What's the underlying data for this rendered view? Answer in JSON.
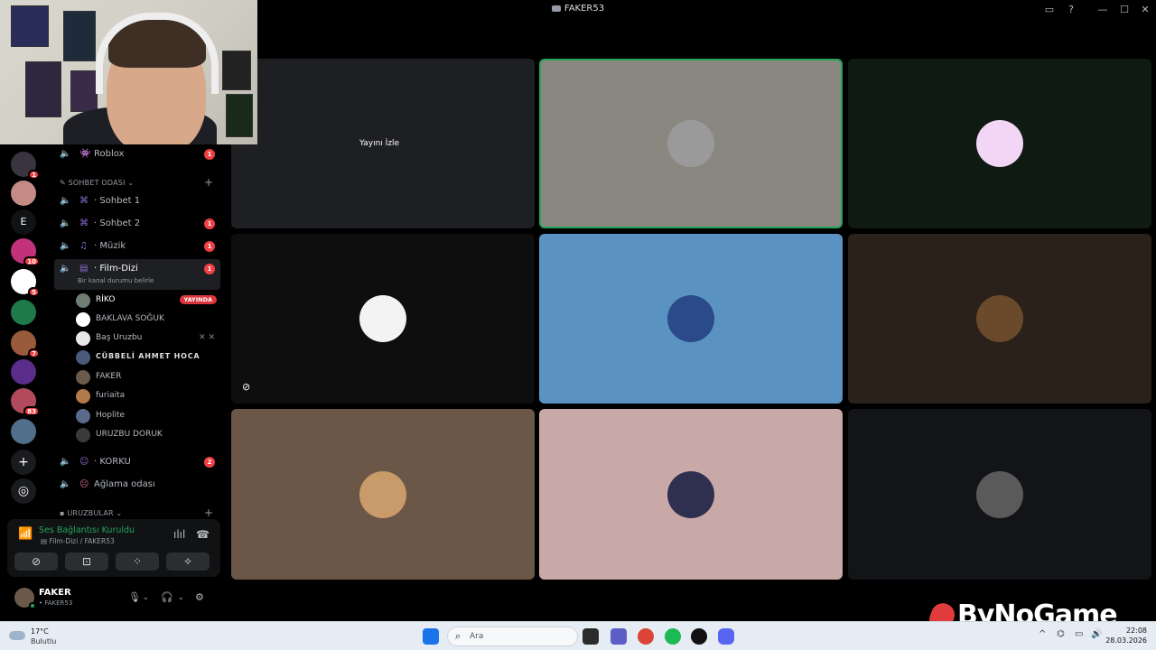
{
  "window": {
    "title": "FAKER53"
  },
  "servers": [
    {
      "name": "server-1",
      "badge": "1",
      "color": "#3a3340"
    },
    {
      "name": "server-2",
      "badge": "",
      "color": "#c48b84"
    },
    {
      "name": "server-3",
      "letter": "E",
      "badge": "",
      "color": "#111214"
    },
    {
      "name": "server-4",
      "badge": "10",
      "color": "#c2327a"
    },
    {
      "name": "server-5",
      "badge": "5",
      "color": "#ffffff"
    },
    {
      "name": "server-6",
      "badge": "",
      "color": "#1e7a4a"
    },
    {
      "name": "server-7",
      "badge": "7",
      "color": "#9a5b3c"
    },
    {
      "name": "server-8",
      "badge": "",
      "color": "#5a2d8a"
    },
    {
      "name": "server-9",
      "badge": "83",
      "color": "#b04a5c"
    },
    {
      "name": "server-10",
      "badge": "",
      "color": "#4f6f8a"
    }
  ],
  "channels": {
    "roblox": {
      "name": "Roblox",
      "count": "1"
    },
    "category_chat": "SOHBET ODASI",
    "sohbet1": {
      "name": "· Sohbet 1",
      "count": ""
    },
    "sohbet2": {
      "name": "· Sohbet 2",
      "count": "1"
    },
    "muzik": {
      "name": "· Müzik",
      "count": "1"
    },
    "film": {
      "name": "· Film-Dizi",
      "count": "1",
      "status": "Bir kanal durumu belirle"
    },
    "korku": {
      "name": "· KORKU",
      "count": "2"
    },
    "aglama": {
      "name": "Ağlama odası"
    },
    "category_uruzbular": "URUZBULAR"
  },
  "voice_users": [
    {
      "name": "RİKO",
      "badge": "YAYINDA",
      "color": "#6f7d72",
      "style": "bold"
    },
    {
      "name": "BAKLAVA SOĞUK",
      "color": "#ffffff",
      "style": ""
    },
    {
      "name": "Baş Uruzbu",
      "color": "#e8e8e8",
      "style": ""
    },
    {
      "name": "CÜBBELİ AHMET HOCA",
      "color": "#4a5a7a",
      "style": "fancy"
    },
    {
      "name": "FAKER",
      "color": "#6b5a4a",
      "style": ""
    },
    {
      "name": "furiaita",
      "color": "#b07a4a",
      "style": ""
    },
    {
      "name": "Hoplite",
      "color": "#5a6a8a",
      "style": ""
    },
    {
      "name": "URUZBU DORUK",
      "color": "#3a3a3a",
      "style": ""
    }
  ],
  "voice_panel": {
    "status": "Ses Bağlantısı Kuruldu",
    "channel": "Film-Dizi / FAKER53"
  },
  "user": {
    "name": "FAKER",
    "sub": "• FAKER53"
  },
  "stream": {
    "watch_label": "Yayını İzle"
  },
  "tiles": [
    {
      "bg": "#1e1f22",
      "avatar": "",
      "speaking": false
    },
    {
      "bg": "#8a8780",
      "avatar": "#9a9a9a",
      "speaking": true
    },
    {
      "bg": "#0f1a12",
      "avatar": "#f3d6f6",
      "speaking": false
    },
    {
      "bg": "#0e0e0f",
      "avatar": "#f3f3f3",
      "speaking": false
    },
    {
      "bg": "#5a93c2",
      "avatar": "#2a4a8a",
      "speaking": false
    },
    {
      "bg": "#2b211b",
      "avatar": "#6a4a2a",
      "speaking": false
    },
    {
      "bg": "#6b5747",
      "avatar": "#c99a6a",
      "speaking": false
    },
    {
      "bg": "#c9a9a8",
      "avatar": "#2f2f4f",
      "speaking": false
    },
    {
      "bg": "#131417",
      "avatar": "#5a5a5a",
      "speaking": false
    }
  ],
  "watermark": "ByNoGame",
  "taskbar": {
    "temp": "17°C",
    "condition": "Bulutlu",
    "search_placeholder": "Ara",
    "time": "22:08",
    "date": "28.03.2026"
  }
}
